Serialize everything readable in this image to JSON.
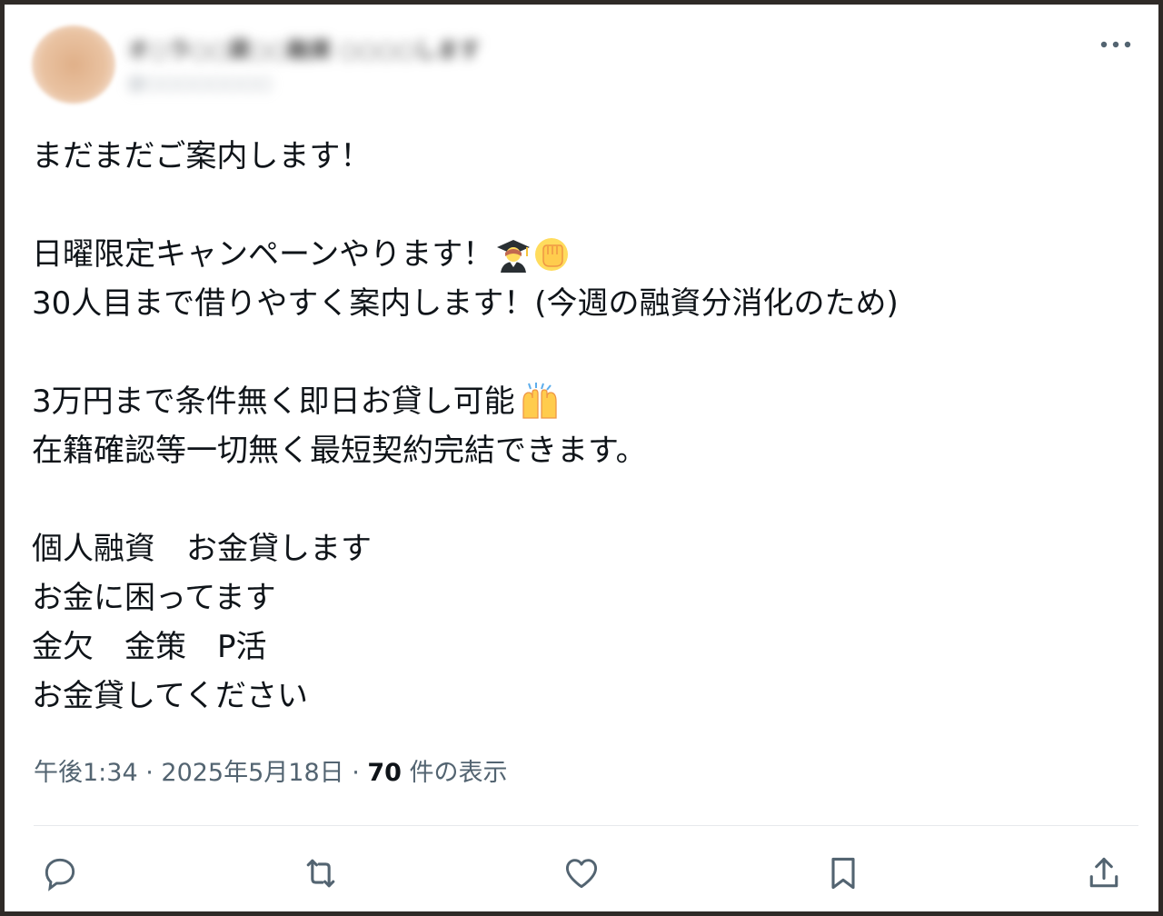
{
  "author": {
    "name": "オ○ラ○○貸○○融資 ○○○○します",
    "handle": "@○○○○○○○○"
  },
  "tweet": {
    "lines": [
      "まだまだご案内します！",
      "",
      "日曜限定キャンペーンやります！",
      "30人目まで借りやすく案内します！(今週の融資分消化のため)",
      "",
      "3万円まで条件無く即日お貸し可能",
      "在籍確認等一切無く最短契約完結できます。",
      "",
      "個人融資　お金貸します",
      "お金に困ってます",
      "金欠　金策　P活",
      "お金貸してください"
    ]
  },
  "meta": {
    "time": "午後1:34",
    "sep1": " · ",
    "date": "2025年5月18日",
    "sep2": " · ",
    "views_count": "70",
    "views_label": " 件の表示"
  },
  "icons": {
    "more": "more-icon",
    "reply": "reply-icon",
    "retweet": "retweet-icon",
    "like": "like-icon",
    "bookmark": "bookmark-icon",
    "share": "share-icon"
  },
  "colors": {
    "text": "#0f1419",
    "secondary": "#536471",
    "divider": "#e6e9ec"
  }
}
